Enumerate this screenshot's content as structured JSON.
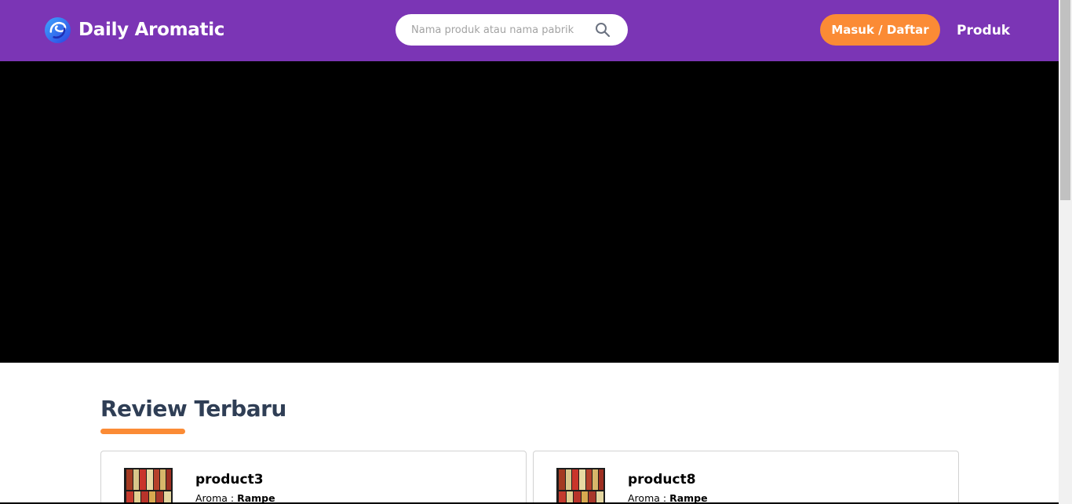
{
  "brand": {
    "name": "Daily Aromatic"
  },
  "search": {
    "placeholder": "Nama produk atau nama pabrik"
  },
  "nav": {
    "login_label": "Masuk / Daftar",
    "products_link": "Produk"
  },
  "section": {
    "title": "Review Terbaru"
  },
  "reviews": [
    {
      "name": "product3",
      "aroma_label": "Aroma :",
      "aroma_value": "Rampe"
    },
    {
      "name": "product8",
      "aroma_label": "Aroma :",
      "aroma_value": "Rampe"
    }
  ],
  "colors": {
    "navbar": "#7b35b5",
    "accent": "#fb8b35",
    "heading": "#2f3e55",
    "hero": "#000000"
  },
  "icons": [
    "brand-logo-icon",
    "search-icon"
  ]
}
